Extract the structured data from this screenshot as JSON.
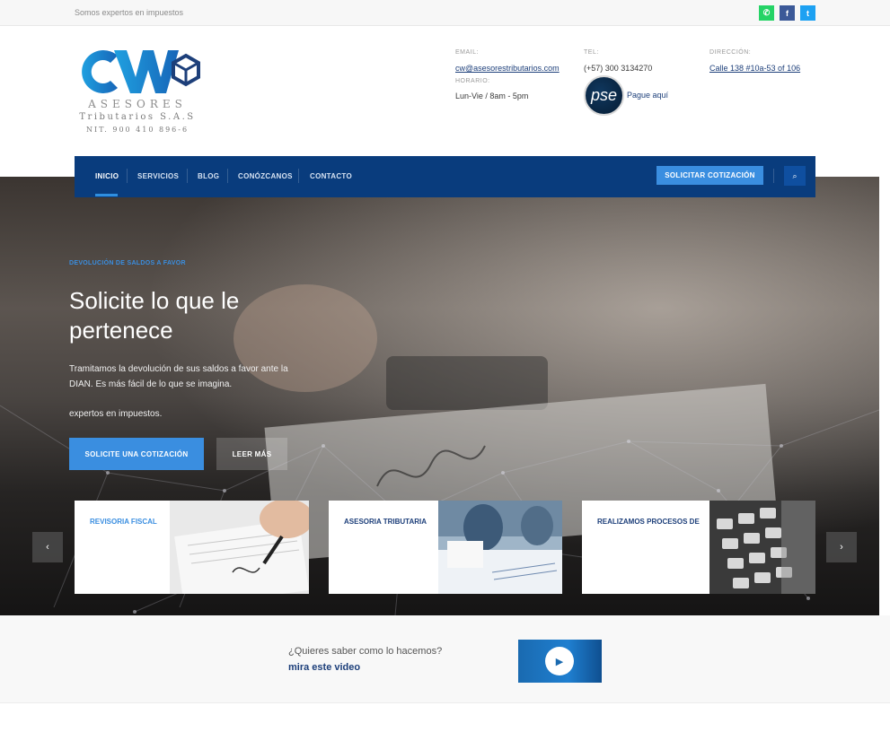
{
  "topbar": {
    "tagline": "Somos expertos en impuestos",
    "social": [
      {
        "name": "whatsapp",
        "glyph": "✆",
        "color": "#25d366"
      },
      {
        "name": "facebook",
        "glyph": "f",
        "color": "#3b5998"
      },
      {
        "name": "twitter",
        "glyph": "t",
        "color": "#1da1f2"
      }
    ]
  },
  "logo": {
    "mark": "CW",
    "line1": "ASESORES",
    "line2": "Tributarios S.A.S",
    "line3": "NIT. 900 410 896-6"
  },
  "contact": {
    "email_label": "EMAIL:",
    "email": "cw@asesorestributarios.com",
    "hours_label": "HORARIO:",
    "hours": "Lun-Vie / 8am - 5pm",
    "tel_label": "TEL:",
    "tel": "(+57) 300 3134270",
    "address_label": "DIRECCIÓN:",
    "address": "Calle 138 #10a-53 of 106",
    "pse_logo": "pse",
    "pse_text": "Pague aquí"
  },
  "nav": {
    "items": [
      "INICIO",
      "SERVICIOS",
      "BLOG",
      "CONÓZCANOS",
      "CONTACTO"
    ],
    "cta": "SOLICITAR COTIZACIÓN",
    "search_icon": "⌕"
  },
  "hero": {
    "eyebrow": "DEVOLUCIÓN DE SALDOS A FAVOR",
    "title": "Solicite lo que le pertenece",
    "lead": "Tramitamos la devolución de sus saldos a favor ante la DIAN. Es más fácil de lo que se imagina.",
    "lead2": "expertos en impuestos.",
    "primary_button": "SOLICITE UNA COTIZACIÓN",
    "secondary_button": "LEER MÁS"
  },
  "cards": [
    {
      "title": "REVISORIA FISCAL",
      "accent": "#3a8ee0"
    },
    {
      "title": "ASESORIA TRIBUTARIA",
      "accent": "#1d3f7a"
    },
    {
      "title": "REALIZAMOS PROCESOS DE",
      "accent": "#1d3f7a"
    }
  ],
  "slider": {
    "prev": "‹",
    "next": "›"
  },
  "video": {
    "question": "¿Quieres saber como lo hacemos?",
    "link": "mira este video",
    "play_icon": "▶"
  },
  "colors": {
    "brand": "#093c7d",
    "accent": "#3a8ee0"
  }
}
